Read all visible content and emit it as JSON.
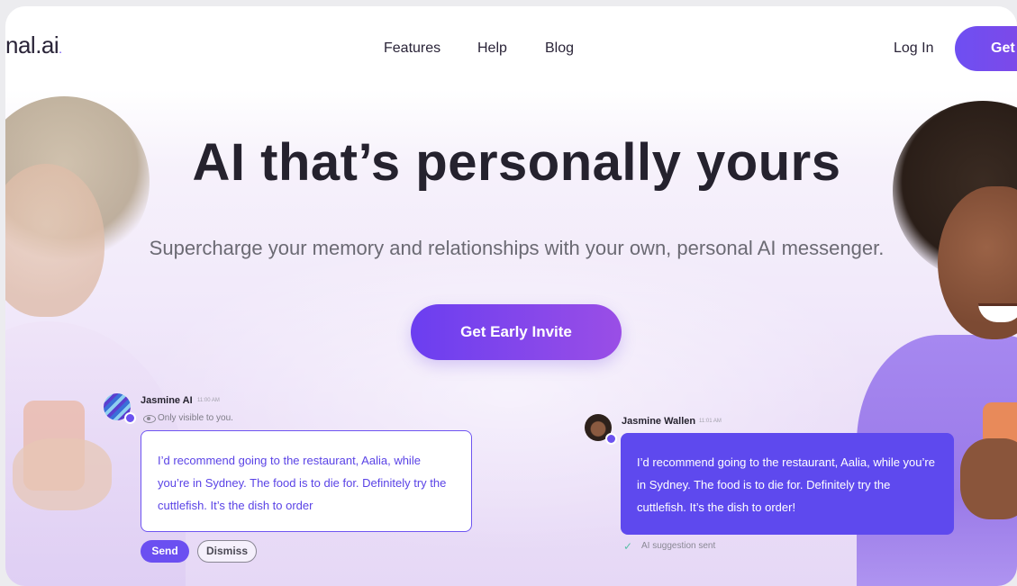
{
  "header": {
    "logo_text": "nal.ai",
    "logo_dot": ".",
    "nav": [
      "Features",
      "Help",
      "Blog"
    ],
    "login": "Log In",
    "cta": "Get"
  },
  "hero": {
    "title": "AI that’s personally yours",
    "subtitle": "Supercharge your memory and relationships with your own, personal AI messenger.",
    "cta": "Get Early Invite"
  },
  "chat_left": {
    "name": "Jasmine AI",
    "time": "11:00 AM",
    "visibility_note": "Only visible to you.",
    "message": "I’d recommend going to the restaurant, Aalia, while you’re in Sydney. The food is to die for. Definitely try the cuttlefish. It’s the dish to order",
    "send": "Send",
    "dismiss": "Dismiss"
  },
  "chat_right": {
    "name": "Jasmine Wallen",
    "time": "11:01 AM",
    "message": "I’d recommend going to the restaurant, Aalia, while you’re in Sydney. The food is to die for. Definitely try the cuttlefish. It’s the dish to order!",
    "status": "AI suggestion sent"
  },
  "icons": {
    "visibility": "eye-icon",
    "sent": "checkmark-icon"
  },
  "colors": {
    "accent": "#6b4ff1",
    "bubble_user": "#5e49ee",
    "text_dark": "#25222e"
  }
}
